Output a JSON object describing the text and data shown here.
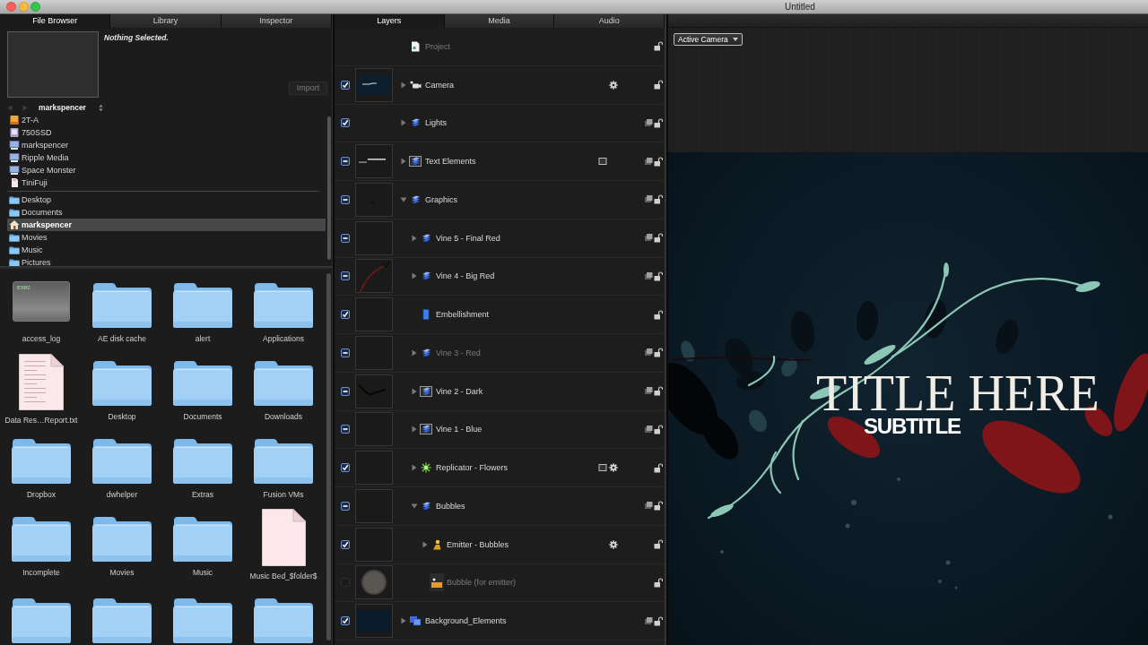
{
  "window": {
    "title": "Untitled"
  },
  "file_browser": {
    "tabs": [
      {
        "label": "File Browser",
        "selected": true
      },
      {
        "label": "Library",
        "selected": false
      },
      {
        "label": "Inspector",
        "selected": false
      }
    ],
    "preview": {
      "status": "Nothing Selected.",
      "import_button": {
        "label": "Import",
        "disabled": true
      }
    },
    "path_bar": {
      "back_disabled": true,
      "forward_disabled": true,
      "folder": "markspencer"
    },
    "devices": [
      {
        "label": "2T-A",
        "kind": "external",
        "selected": false
      },
      {
        "label": "750SSD",
        "kind": "internal",
        "selected": false
      },
      {
        "label": "markspencer",
        "kind": "server",
        "selected": false
      },
      {
        "label": "Ripple Media",
        "kind": "server",
        "selected": false
      },
      {
        "label": "Space Monster",
        "kind": "server",
        "selected": false
      },
      {
        "label": "TiniFuji",
        "kind": "card",
        "selected": false
      }
    ],
    "places": [
      {
        "label": "Desktop",
        "kind": "folder",
        "selected": false
      },
      {
        "label": "Documents",
        "kind": "folder",
        "selected": false
      },
      {
        "label": "markspencer",
        "kind": "home",
        "selected": true
      },
      {
        "label": "Movies",
        "kind": "folder",
        "selected": false
      },
      {
        "label": "Music",
        "kind": "folder",
        "selected": false
      },
      {
        "label": "Pictures",
        "kind": "folder",
        "selected": false
      }
    ],
    "files": [
      {
        "name": "access_log",
        "kind": "exec",
        "icon_text": "exec"
      },
      {
        "name": "AE disk cache",
        "kind": "folder"
      },
      {
        "name": "alert",
        "kind": "folder"
      },
      {
        "name": "Applications",
        "kind": "folder"
      },
      {
        "name": "Data Res…Report.txt",
        "kind": "text"
      },
      {
        "name": "Desktop",
        "kind": "folder"
      },
      {
        "name": "Documents",
        "kind": "folder"
      },
      {
        "name": "Downloads",
        "kind": "folder"
      },
      {
        "name": "Dropbox",
        "kind": "folder"
      },
      {
        "name": "dwhelper",
        "kind": "folder"
      },
      {
        "name": "Extras",
        "kind": "folder"
      },
      {
        "name": "Fusion VMs",
        "kind": "folder"
      },
      {
        "name": "Incomplete",
        "kind": "folder"
      },
      {
        "name": "Movies",
        "kind": "folder"
      },
      {
        "name": "Music",
        "kind": "folder"
      },
      {
        "name": "Music Bed_$folder$",
        "kind": "document"
      },
      {
        "kind": "folder"
      },
      {
        "kind": "folder"
      },
      {
        "kind": "folder"
      },
      {
        "kind": "folder"
      }
    ]
  },
  "layers_panel": {
    "tabs": [
      {
        "label": "Layers",
        "selected": true
      },
      {
        "label": "Media",
        "selected": false
      },
      {
        "label": "Audio",
        "selected": false
      }
    ],
    "layers": [
      {
        "name": "Project",
        "kind": "project",
        "filters": false,
        "behaviors": false,
        "disabled": true,
        "locked": false
      },
      {
        "name": "Camera",
        "kind": "camera",
        "checked": true,
        "mixed": false,
        "thumbnail": {
          "kind": "camera"
        },
        "expanded": false,
        "filters": false,
        "behaviors": true,
        "disabled": false,
        "locked": false
      },
      {
        "name": "Lights",
        "kind": "group",
        "checked": true,
        "mixed": false,
        "expanded": false,
        "filters": false,
        "behaviors": false,
        "disabled": false,
        "locked": false
      },
      {
        "name": "Text Elements",
        "kind": "framed-group",
        "checked": true,
        "mixed": true,
        "thumbnail": {
          "kind": "title"
        },
        "expanded": false,
        "filters": true,
        "behaviors": false,
        "disabled": false,
        "locked": false
      },
      {
        "name": "Graphics",
        "kind": "group",
        "checked": true,
        "mixed": true,
        "thumbnail": {
          "kind": "speck"
        },
        "expanded": true,
        "filters": false,
        "behaviors": false,
        "disabled": false,
        "locked": false,
        "children": [
          {
            "name": "Vine 5 - Final Red",
            "kind": "group",
            "checked": true,
            "mixed": true,
            "thumbnail": {
              "kind": "blank"
            },
            "expanded": false,
            "filters": false,
            "behaviors": false,
            "disabled": false,
            "locked": false
          },
          {
            "name": "Vine 4 - Big Red",
            "kind": "group",
            "checked": true,
            "mixed": true,
            "thumbnail": {
              "kind": "red-vine"
            },
            "expanded": false,
            "filters": false,
            "behaviors": false,
            "disabled": false,
            "locked": false
          },
          {
            "name": "Embellishment",
            "kind": "shape",
            "checked": true,
            "mixed": false,
            "thumbnail": {
              "kind": "blank"
            },
            "filters": false,
            "behaviors": false,
            "disabled": false,
            "locked": false
          },
          {
            "name": "Vine 3 - Red",
            "kind": "group",
            "checked": true,
            "mixed": true,
            "thumbnail": {
              "kind": "blank"
            },
            "expanded": false,
            "filters": false,
            "behaviors": false,
            "disabled": true,
            "locked": false
          },
          {
            "name": "Vine 2 - Dark",
            "kind": "framed-group",
            "checked": true,
            "mixed": true,
            "thumbnail": {
              "kind": "dark-vine"
            },
            "expanded": false,
            "filters": false,
            "behaviors": false,
            "disabled": false,
            "locked": false
          },
          {
            "name": "Vine 1 - Blue",
            "kind": "framed-group",
            "checked": true,
            "mixed": true,
            "thumbnail": {
              "kind": "blank"
            },
            "expanded": false,
            "filters": false,
            "behaviors": false,
            "disabled": false,
            "locked": false
          },
          {
            "name": "Replicator - Flowers",
            "kind": "replicator",
            "checked": true,
            "mixed": false,
            "thumbnail": {
              "kind": "blank"
            },
            "expanded": false,
            "filters": true,
            "behaviors": true,
            "disabled": false,
            "locked": false
          },
          {
            "name": "Bubbles",
            "kind": "group",
            "checked": true,
            "mixed": true,
            "thumbnail": {
              "kind": "blank"
            },
            "expanded": true,
            "filters": false,
            "behaviors": false,
            "disabled": false,
            "locked": false,
            "children": [
              {
                "name": "Emitter - Bubbles",
                "kind": "emitter",
                "checked": true,
                "mixed": false,
                "thumbnail": {
                  "kind": "blank"
                },
                "expanded": false,
                "filters": false,
                "behaviors": true,
                "disabled": false,
                "locked": false
              },
              {
                "name": "Bubble (for emitter)",
                "kind": "image",
                "checked": false,
                "mixed": false,
                "thumbnail": {
                  "kind": "bubble"
                },
                "filters": false,
                "behaviors": false,
                "disabled": true,
                "locked": false
              }
            ]
          }
        ]
      },
      {
        "name": "Background_Elements",
        "kind": "stacked-group",
        "checked": true,
        "mixed": false,
        "thumbnail": {
          "kind": "gradient"
        },
        "expanded": false,
        "filters": false,
        "behaviors": false,
        "disabled": false,
        "locked": false
      }
    ]
  },
  "canvas": {
    "camera_menu": "Active Camera",
    "title_text": "TITLE HERE",
    "subtitle_text": "SUBTITLE"
  }
}
